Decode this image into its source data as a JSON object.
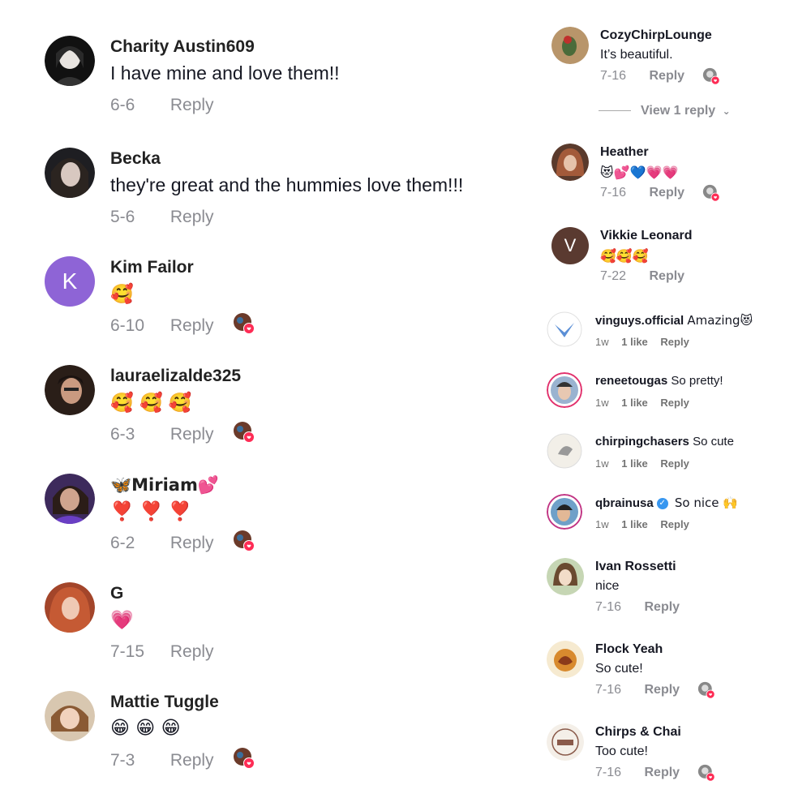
{
  "left_comments": [
    {
      "name": "Charity Austin609",
      "text": "I have mine and love them!!",
      "date": "6-6",
      "reply": "Reply",
      "liked": false
    },
    {
      "name": "Becka",
      "text": "they're great and the hummies love them!!!",
      "date": "5-6",
      "reply": "Reply",
      "liked": false
    },
    {
      "name": "Kim Failor",
      "text": "🥰",
      "date": "6-10",
      "reply": "Reply",
      "liked": true,
      "avatar_letter": "K"
    },
    {
      "name": "lauraelizalde325",
      "text": "🥰 🥰 🥰",
      "date": "6-3",
      "reply": "Reply",
      "liked": true
    },
    {
      "name": "🦋Miriam💕",
      "text": "❣️ ❣️ ❣️",
      "date": "6-2",
      "reply": "Reply",
      "liked": true
    },
    {
      "name": "G",
      "text": "💗",
      "date": "7-15",
      "reply": "Reply",
      "liked": false
    },
    {
      "name": "Mattie Tuggle",
      "text": "😁 😁 😁",
      "date": "7-3",
      "reply": "Reply",
      "liked": true
    }
  ],
  "right_top": [
    {
      "name": "CozyChirpLounge",
      "text": "It’s beautiful.",
      "date": "7-16",
      "reply": "Reply",
      "liked": true
    },
    {
      "name": "Heather",
      "text": "😻💕💙💗💗",
      "date": "7-16",
      "reply": "Reply",
      "liked": true
    },
    {
      "name": "Vikkie Leonard",
      "text": "🥰🥰🥰",
      "date": "7-22",
      "reply": "Reply",
      "liked": false,
      "avatar_letter": "V"
    }
  ],
  "view_reply": "View 1 reply",
  "insta_comments": [
    {
      "user": "vinguys.official",
      "text": "Amazing😻",
      "time": "1w",
      "likes": "1 like",
      "reply": "Reply"
    },
    {
      "user": "reneetougas",
      "text": "So pretty!",
      "time": "1w",
      "likes": "1 like",
      "reply": "Reply"
    },
    {
      "user": "chirpingchasers",
      "text": "So cute",
      "time": "1w",
      "likes": "1 like",
      "reply": "Reply"
    },
    {
      "user": "qbrainusa",
      "text": "So nice 🙌",
      "time": "1w",
      "likes": "1 like",
      "reply": "Reply",
      "verified": true
    }
  ],
  "right_bottom": [
    {
      "name": "Ivan Rossetti",
      "text": "nice",
      "date": "7-16",
      "reply": "Reply",
      "liked": false
    },
    {
      "name": "Flock Yeah",
      "text": "So cute!",
      "date": "7-16",
      "reply": "Reply",
      "liked": true
    },
    {
      "name": "Chirps & Chai",
      "text": "Too cute!",
      "date": "7-16",
      "reply": "Reply",
      "liked": true
    }
  ],
  "colors": {
    "accent_red": "#fe2c55",
    "purple_avatar": "#8e64d6",
    "brown_avatar": "#5a3a30",
    "meta_gray": "#8a8b91",
    "verified_blue": "#3897f0"
  }
}
